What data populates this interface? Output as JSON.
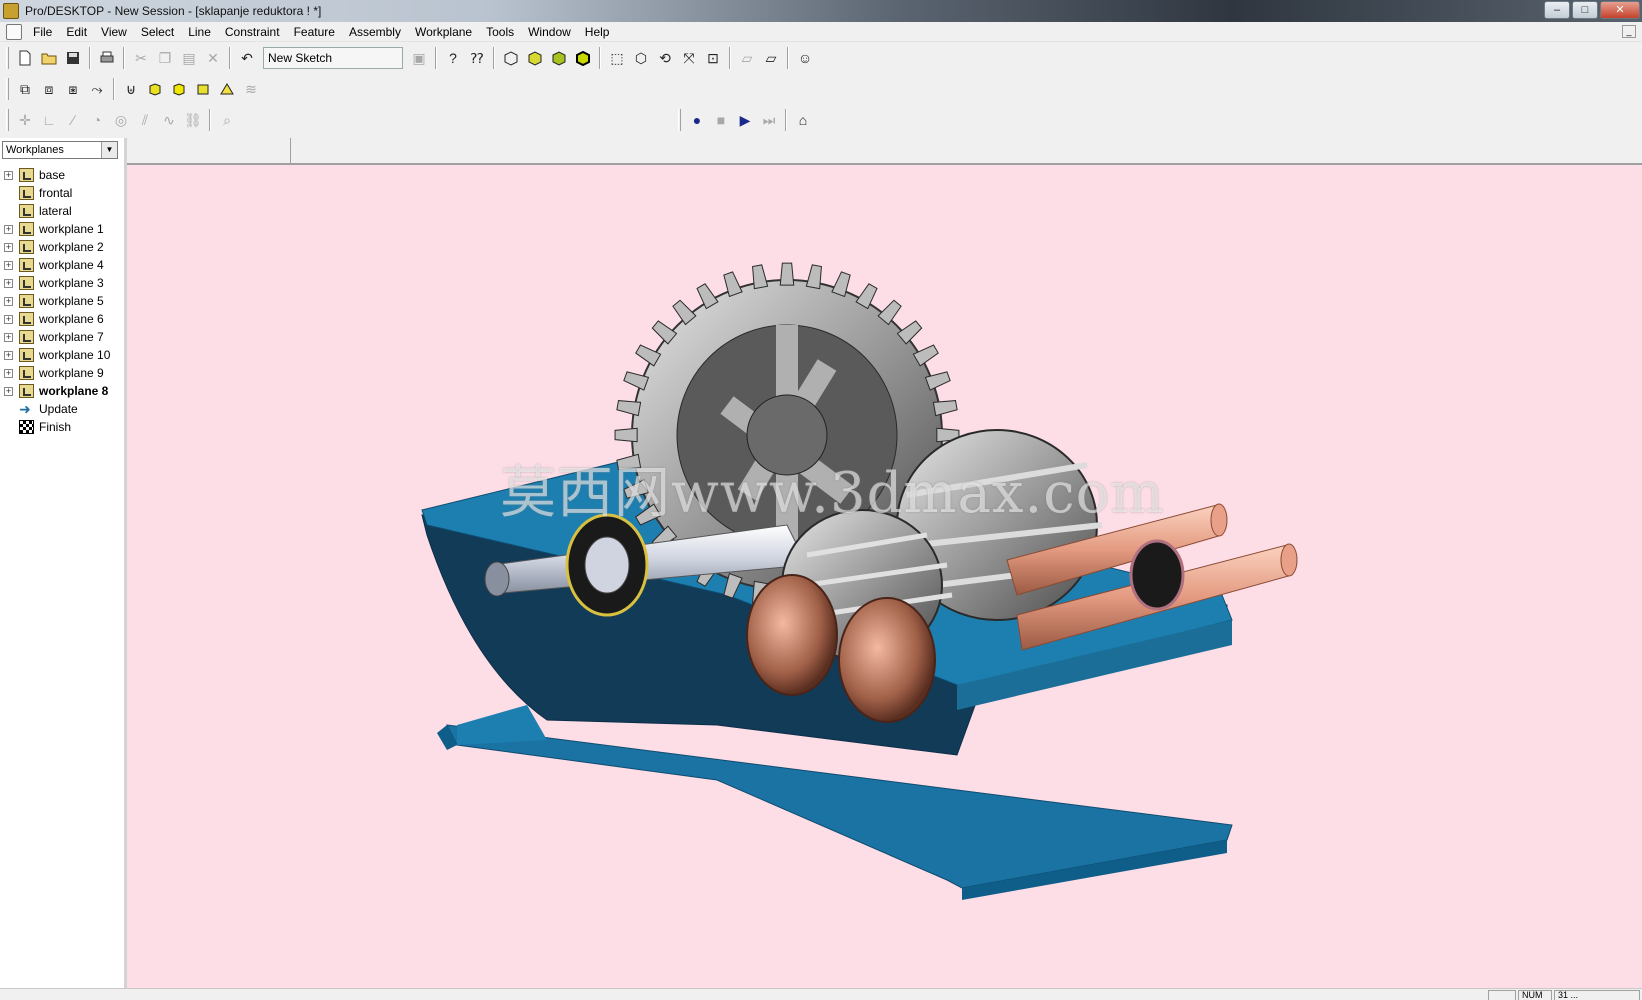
{
  "window": {
    "title": "Pro/DESKTOP - New Session - [sklapanje reduktora ! *]",
    "min_label": "–",
    "max_label": "□",
    "close_label": "✕"
  },
  "menu": [
    "File",
    "Edit",
    "View",
    "Select",
    "Line",
    "Constraint",
    "Feature",
    "Assembly",
    "Workplane",
    "Tools",
    "Window",
    "Help"
  ],
  "toolbar": {
    "sketch_combo": "New Sketch"
  },
  "browser": {
    "selector_value": "Workplanes",
    "items": [
      {
        "label": "base",
        "expandable": true,
        "type": "workplane"
      },
      {
        "label": "frontal",
        "expandable": false,
        "type": "workplane"
      },
      {
        "label": "lateral",
        "expandable": false,
        "type": "workplane"
      },
      {
        "label": "workplane 1",
        "expandable": true,
        "type": "workplane"
      },
      {
        "label": "workplane 2",
        "expandable": true,
        "type": "workplane"
      },
      {
        "label": "workplane 4",
        "expandable": true,
        "type": "workplane"
      },
      {
        "label": "workplane 3",
        "expandable": true,
        "type": "workplane"
      },
      {
        "label": "workplane 5",
        "expandable": true,
        "type": "workplane"
      },
      {
        "label": "workplane 6",
        "expandable": true,
        "type": "workplane"
      },
      {
        "label": "workplane 7",
        "expandable": true,
        "type": "workplane"
      },
      {
        "label": "workplane 10",
        "expandable": true,
        "type": "workplane"
      },
      {
        "label": "workplane 9",
        "expandable": true,
        "type": "workplane"
      },
      {
        "label": "workplane 8",
        "expandable": true,
        "type": "workplane",
        "active": true
      },
      {
        "label": "Update",
        "expandable": false,
        "type": "update"
      },
      {
        "label": "Finish",
        "expandable": false,
        "type": "finish"
      }
    ]
  },
  "viewport": {
    "background": "#fddde6",
    "watermark": "莫西网www.3dmax.com"
  },
  "status": {
    "num": "NUM",
    "date": "31 ..."
  },
  "colors": {
    "housing": "#1d7fb0",
    "gear": "#9a9a9a",
    "shaft": "#e8a088"
  }
}
